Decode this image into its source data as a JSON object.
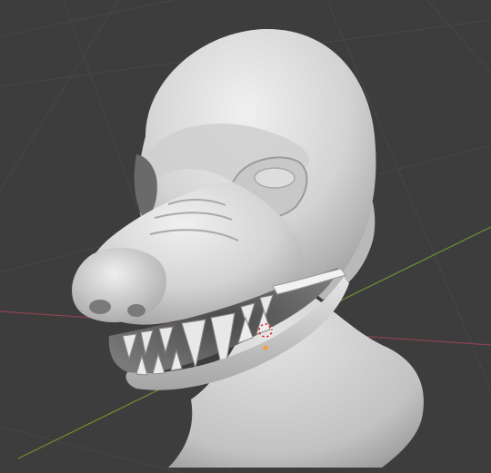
{
  "viewport": {
    "mode": "3d-viewport",
    "background_color": "#3d3d3d",
    "grid_line_color": "#474747",
    "x_axis_color": "#8c4450",
    "y_axis_color": "#6f8f32"
  },
  "scene": {
    "object": "sculpted-wolf-head-mask",
    "material_color": "#d9d9d9",
    "shadow_color": "#8c8c8c",
    "cursor_icon": "3d-cursor-icon",
    "origin_icon": "object-origin-icon",
    "origin_color": "#ff9a2e"
  }
}
